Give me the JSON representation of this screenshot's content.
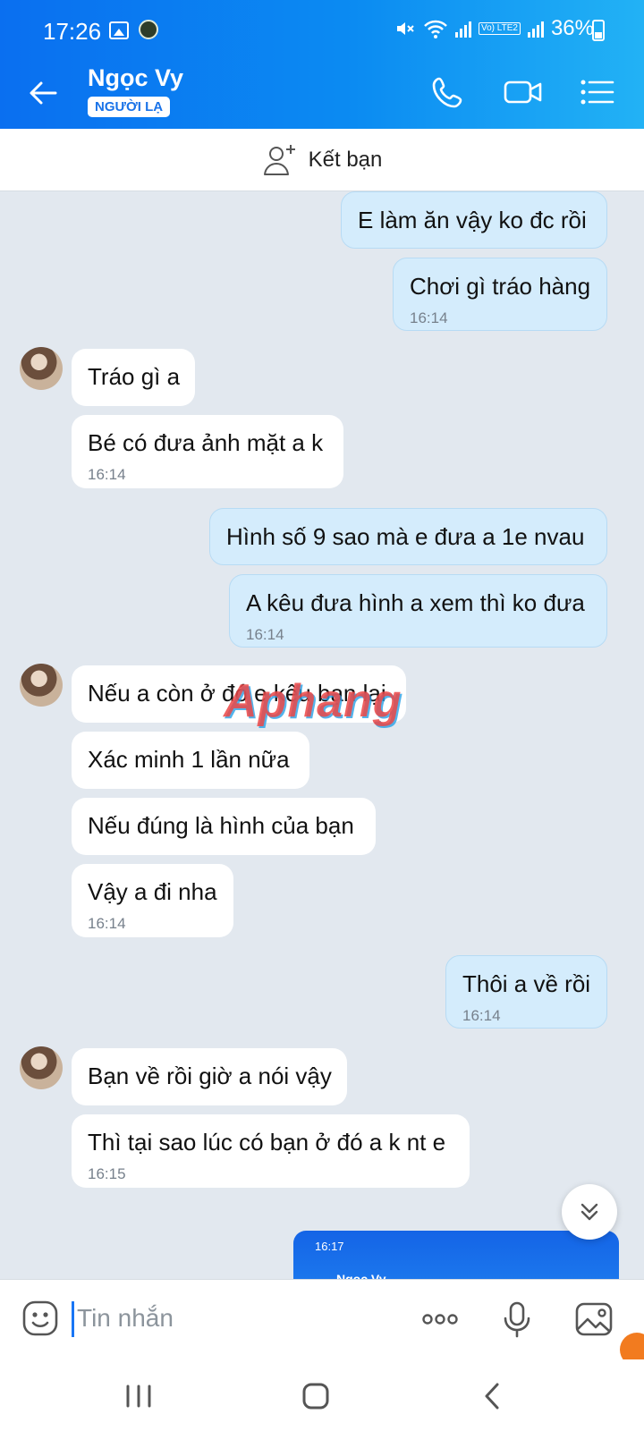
{
  "status_bar": {
    "time": "17:26",
    "battery": "36%",
    "lte_label": "Vo) LTE2"
  },
  "header": {
    "contact_name": "Ngọc Vy",
    "badge": "NGƯỜI LẠ"
  },
  "friend_bar": {
    "label": "Kết bạn"
  },
  "messages": [
    {
      "side": "out",
      "text": "E làm ăn vậy ko đc rồi",
      "time": ""
    },
    {
      "side": "out",
      "text": "Chơi gì tráo hàng",
      "time": "16:14"
    },
    {
      "side": "in",
      "text": "Tráo gì a",
      "time": ""
    },
    {
      "side": "in",
      "text": "Bé có đưa ảnh mặt a k",
      "time": "16:14"
    },
    {
      "side": "out",
      "text": "Hình số 9 sao mà e đưa a 1e nvau",
      "time": ""
    },
    {
      "side": "out",
      "text": "A kêu đưa hình a xem thì ko đưa",
      "time": "16:14"
    },
    {
      "side": "in",
      "text": "Nếu a còn ở đó e kêu bạn lại",
      "time": ""
    },
    {
      "side": "in",
      "text": "Xác minh 1 lần nữa",
      "time": ""
    },
    {
      "side": "in",
      "text": "Nếu đúng là hình của bạn",
      "time": ""
    },
    {
      "side": "in",
      "text": "Vậy a đi nha",
      "time": "16:14"
    },
    {
      "side": "out",
      "text": "Thôi a về rồi",
      "time": "16:14"
    },
    {
      "side": "in",
      "text": "Bạn về rồi giờ a nói vậy",
      "time": ""
    },
    {
      "side": "in",
      "text": "Thì tại sao lúc có bạn ở đó a k nt e",
      "time": "16:15"
    }
  ],
  "image_preview": {
    "time": "16:17",
    "name": "Ngọc Vy"
  },
  "watermark": "Aphang",
  "input": {
    "placeholder": "Tin nhắn"
  },
  "icons": {
    "back": "arrow-left-icon",
    "call": "phone-icon",
    "video": "video-camera-icon",
    "menu": "list-menu-icon",
    "add_friend": "add-user-icon",
    "scroll_down": "chevrons-down-icon",
    "emoji": "emoji-icon",
    "more": "more-dots-icon",
    "mic": "microphone-icon",
    "gallery": "image-icon"
  },
  "colors": {
    "header_start": "#0a6ff0",
    "header_end": "#22b2f5",
    "bubble_out": "#d4ecfc",
    "bubble_in": "#ffffff",
    "chat_bg": "#e2e8ef"
  }
}
